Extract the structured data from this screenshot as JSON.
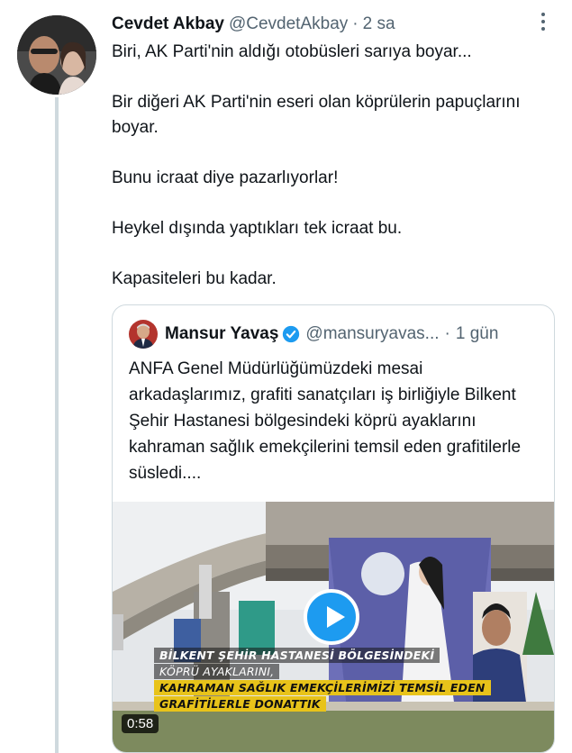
{
  "tweet": {
    "author_name": "Cevdet Akbay",
    "author_handle": "@CevdetAkbay",
    "separator": "·",
    "time": "2 sa",
    "paragraphs": [
      "Biri, AK Parti'nin aldığı otobüsleri sarıya boyar...",
      "Bir diğeri AK Parti'nin eseri olan köprülerin papuçlarını boyar.",
      "Bunu icraat diye pazarlıyorlar!",
      "Heykel dışında yaptıkları tek icraat bu.",
      "Kapasiteleri bu kadar."
    ]
  },
  "quote": {
    "author_name": "Mansur Yavaş",
    "author_handle": "@mansuryavas...",
    "separator": "·",
    "time": "1 gün",
    "text": "ANFA Genel Müdürlüğümüzdeki mesai arkadaşlarımız, grafiti sanatçıları iş birliğiyle Bilkent Şehir Hastanesi bölgesindeki köprü ayaklarını kahraman sağlık emekçilerini temsil eden grafitilerle süsledi....",
    "video": {
      "captions": [
        "BİLKENT ŞEHİR HASTANESİ BÖLGESİNDEKİ",
        "KÖPRÜ AYAKLARINI,",
        "KAHRAMAN SAĞLIK EMEKÇİLERİMİZİ TEMSİL EDEN",
        "GRAFİTİLERLE DONATTIK"
      ],
      "duration": "0:58"
    }
  },
  "icons": {
    "more": "more-dots-icon",
    "verified": "verified-badge-icon",
    "play": "play-icon"
  },
  "colors": {
    "accent": "#1d9bf0",
    "text": "#0f1419",
    "muted": "#536471",
    "caption_highlight": "#e8c31a"
  }
}
